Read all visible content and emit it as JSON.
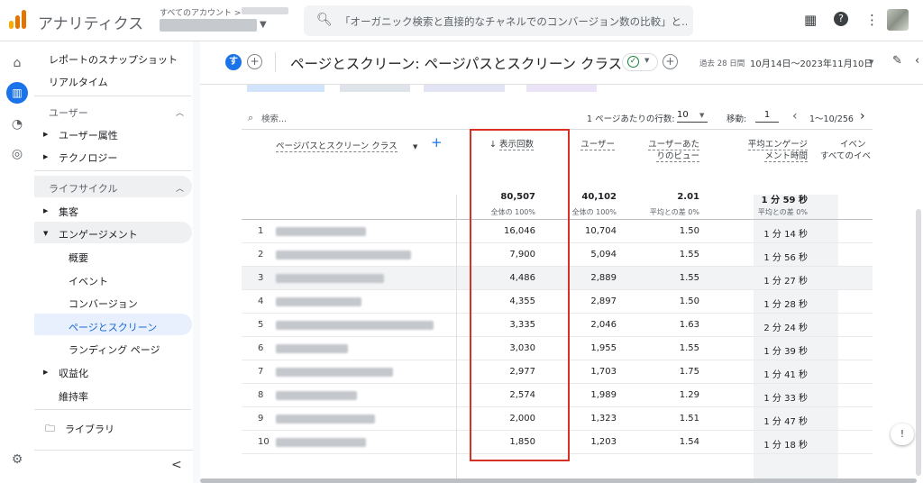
{
  "app": {
    "title": "アナリティクス",
    "account_label": "すべてのアカウント >",
    "search_placeholder": "「オーガニック検索と直接的なチャネルでのコンバージョン数の比較」と..."
  },
  "sidebar": {
    "top_items": [
      "レポートのスナップショット",
      "リアルタイム"
    ],
    "user_section": "ユーザー",
    "user_items": [
      "ユーザー属性",
      "テクノロジー"
    ],
    "lifecycle_section": "ライフサイクル",
    "acquisition": "集客",
    "engagement": "エンゲージメント",
    "engagement_items": [
      "概要",
      "イベント",
      "コンバージョン",
      "ページとスクリーン",
      "ランディング ページ"
    ],
    "monetization": "収益化",
    "retention": "維持率",
    "library": "ライブラリ",
    "collapse": "<"
  },
  "header": {
    "chip_letter": "す",
    "title": "ページとスクリーン: ページパスとスクリーン クラス",
    "date_label": "過去 28 日間",
    "date_range": "10月14日～2023年11月10日"
  },
  "table": {
    "search_placeholder": "検索...",
    "rows_per_page_label": "1 ページあたりの行数:",
    "rows_per_page": "10",
    "goto_label": "移動:",
    "goto_value": "1",
    "pager_text": "1～10/256",
    "dimension_header": "ページパスとスクリーン クラス",
    "columns": [
      {
        "label": "表示回数",
        "total": "80,507",
        "sub": "全体の 100%"
      },
      {
        "label": "ユーザー",
        "total": "40,102",
        "sub": "全体の 100%"
      },
      {
        "label": "ユーザーあたりのビュー",
        "total": "2.01",
        "sub": "平均との差 0%"
      },
      {
        "label": "平均エンゲージメント時間",
        "total": "1 分 59 秒",
        "sub": "平均との差 0%"
      },
      {
        "label": "イベン",
        "label2": "すべてのイベ"
      }
    ],
    "rows": [
      {
        "idx": "1",
        "views": "16,046",
        "users": "10,704",
        "vpu": "1.50",
        "time": "1 分 14 秒"
      },
      {
        "idx": "2",
        "views": "7,900",
        "users": "5,094",
        "vpu": "1.55",
        "time": "1 分 56 秒"
      },
      {
        "idx": "3",
        "views": "4,486",
        "users": "2,889",
        "vpu": "1.55",
        "time": "1 分 27 秒"
      },
      {
        "idx": "4",
        "views": "4,355",
        "users": "2,897",
        "vpu": "1.50",
        "time": "1 分 28 秒"
      },
      {
        "idx": "5",
        "views": "3,335",
        "users": "2,046",
        "vpu": "1.63",
        "time": "2 分 24 秒"
      },
      {
        "idx": "6",
        "views": "3,030",
        "users": "1,955",
        "vpu": "1.55",
        "time": "1 分 39 秒"
      },
      {
        "idx": "7",
        "views": "2,977",
        "users": "1,703",
        "vpu": "1.75",
        "time": "1 分 41 秒"
      },
      {
        "idx": "8",
        "views": "2,574",
        "users": "1,989",
        "vpu": "1.29",
        "time": "1 分 33 秒"
      },
      {
        "idx": "9",
        "views": "2,000",
        "users": "1,323",
        "vpu": "1.51",
        "time": "1 分 47 秒"
      },
      {
        "idx": "10",
        "views": "1,850",
        "users": "1,203",
        "vpu": "1.54",
        "time": "1 分 18 秒"
      }
    ]
  },
  "colors": {
    "accent": "#1a73e8",
    "highlight_box": "#d93025",
    "logo_orange": "#e37400",
    "logo_yellow": "#f9ab00"
  }
}
